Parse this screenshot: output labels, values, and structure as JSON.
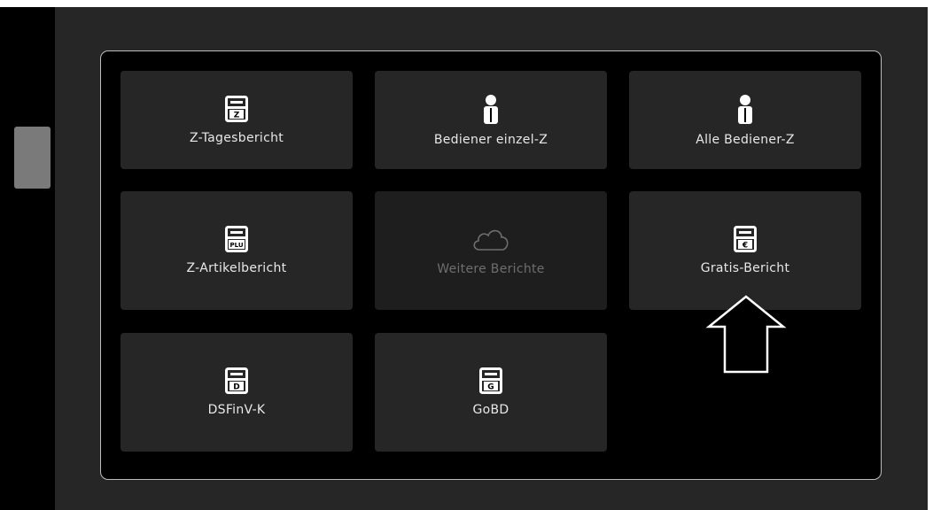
{
  "dialog": {
    "tiles": [
      {
        "label": "Z-Tagesbericht",
        "icon": "register-z-icon",
        "glyph": "Z",
        "enabled": true
      },
      {
        "label": "Bediener einzel-Z",
        "icon": "person-icon",
        "enabled": true
      },
      {
        "label": "Alle Bediener-Z",
        "icon": "person-icon",
        "enabled": true
      },
      {
        "label": "Z-Artikelbericht",
        "icon": "register-plu-icon",
        "glyph": "PLU",
        "enabled": true
      },
      {
        "label": "Weitere Berichte",
        "icon": "cloud-icon",
        "enabled": false
      },
      {
        "label": "Gratis-Bericht",
        "icon": "register-free-icon",
        "glyph": "€",
        "enabled": true
      },
      {
        "label": "DSFinV-K",
        "icon": "register-d-icon",
        "glyph": "D",
        "enabled": true
      },
      {
        "label": "GoBD",
        "icon": "register-g-icon",
        "glyph": "G",
        "enabled": true
      }
    ]
  },
  "annotation": {
    "icon": "up-arrow-icon"
  },
  "colors": {
    "tile": "#262626",
    "tile_disabled": "#1e1e1e",
    "dialog_bg": "#000000",
    "screen_bg": "#262626",
    "tab": "#7a7a7a"
  }
}
